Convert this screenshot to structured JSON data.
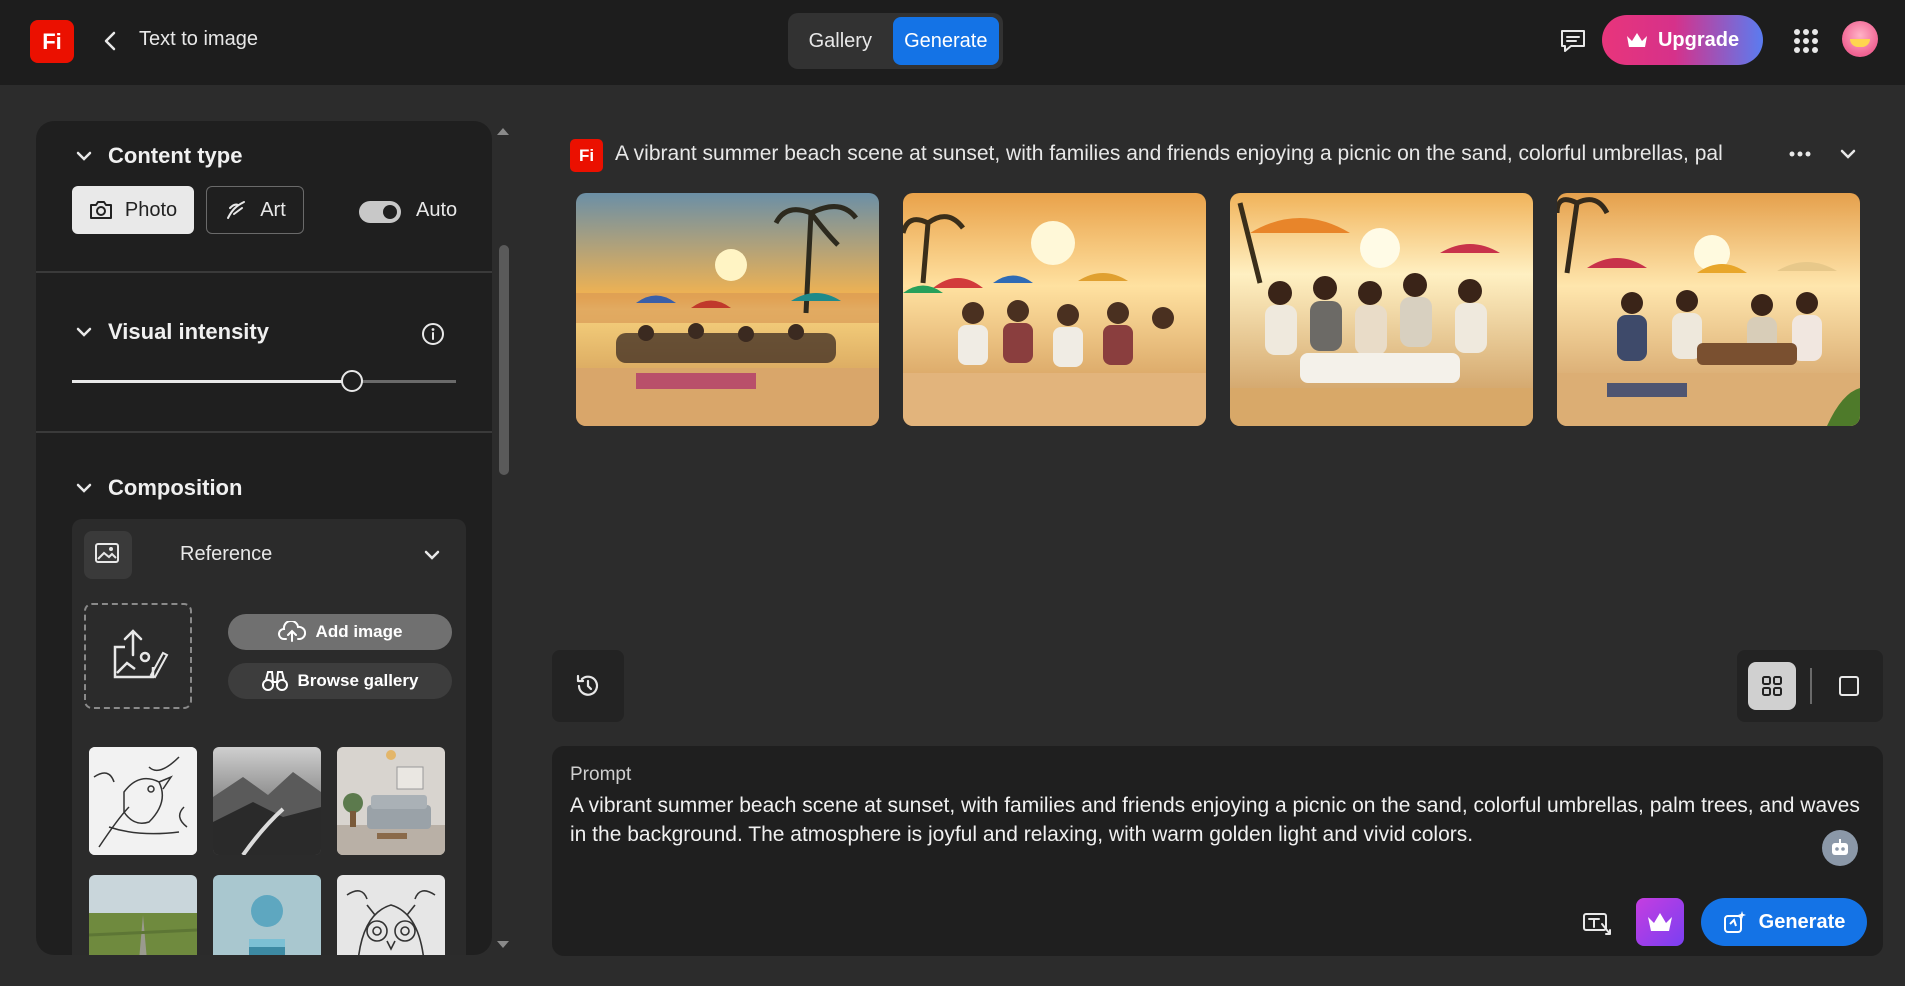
{
  "header": {
    "logo_text": "Fi",
    "back_icon": "chevron-left-icon",
    "title": "Text to image",
    "tabs": [
      {
        "label": "Gallery",
        "active": false
      },
      {
        "label": "Generate",
        "active": true
      }
    ],
    "feedback_icon": "feedback-icon",
    "upgrade_label": "Upgrade",
    "apps_icon": "apps-grid-icon",
    "accent_color": "#1473e6"
  },
  "sidebar": {
    "content_type": {
      "title": "Content type",
      "photo_label": "Photo",
      "art_label": "Art",
      "auto_label": "Auto",
      "auto_on": true,
      "selected": "Photo"
    },
    "visual_intensity": {
      "title": "Visual intensity",
      "value": 0.73
    },
    "composition": {
      "title": "Composition",
      "reference_label": "Reference",
      "add_image_label": "Add image",
      "browse_gallery_label": "Browse gallery"
    }
  },
  "results": {
    "logo_text": "Fi",
    "prompt_title": "A vibrant summer beach scene at sunset, with families and friends enjoying a picnic on the sand, colorful umbrellas, pal"
  },
  "prompt": {
    "label": "Prompt",
    "text": "A vibrant summer beach scene at sunset, with families and friends enjoying a picnic on the sand, colorful umbrellas, palm trees, and waves in the background. The atmosphere is joyful and relaxing, with warm golden light and vivid colors.",
    "generate_label": "Generate"
  }
}
